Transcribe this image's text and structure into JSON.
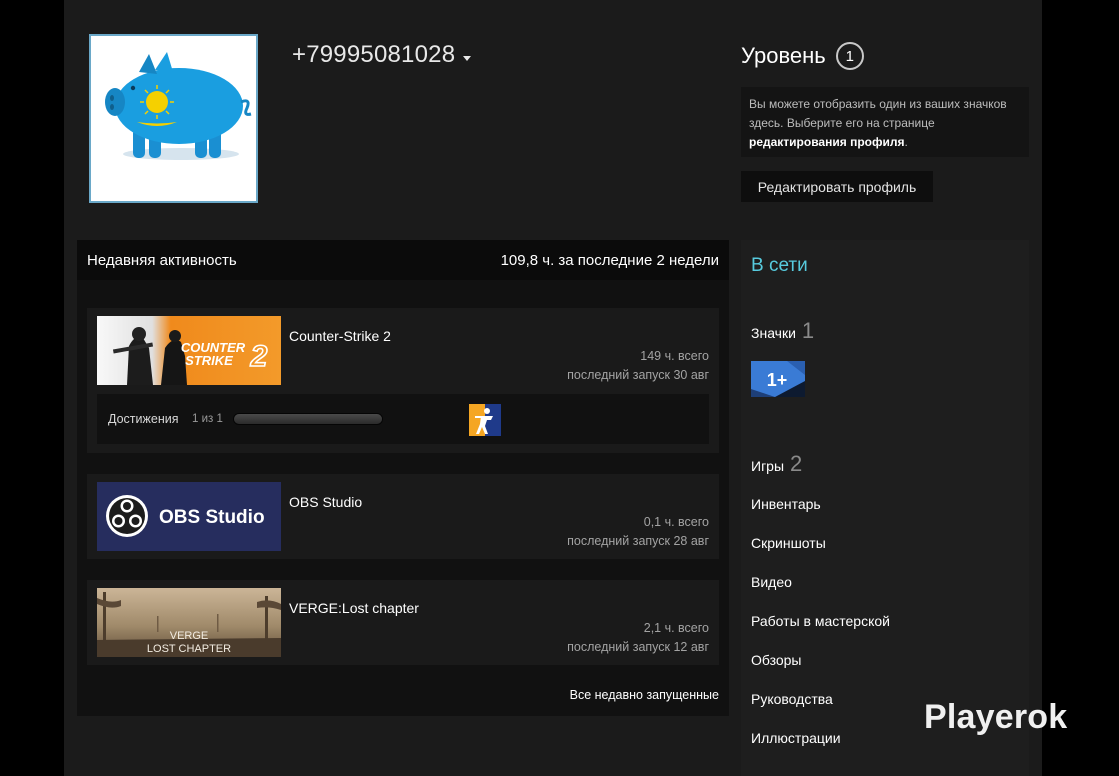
{
  "profile": {
    "persona_name": "+79995081028",
    "level_label": "Уровень",
    "level_value": "1",
    "badge_note_plain": "Вы можете отобразить один из ваших значков здесь. Выберите его на странице ",
    "badge_note_bold": "редактирования профиля",
    "badge_note_end": ".",
    "edit_button": "Редактировать профиль"
  },
  "activity": {
    "title": "Недавняя активность",
    "summary": "109,8 ч. за последние 2 недели",
    "games": [
      {
        "name": "Counter-Strike 2",
        "hours": "149 ч. всего",
        "last_played": "последний запуск 30 авг",
        "capsule_text": [
          "COUNTER",
          "STRIKE",
          "2"
        ],
        "achievements": {
          "label": "Достижения",
          "count": "1 из 1",
          "progress": 1.0
        }
      },
      {
        "name": "OBS Studio",
        "hours": "0,1 ч. всего",
        "last_played": "последний запуск 28 авг",
        "capsule_text": [
          "OBS Studio"
        ]
      },
      {
        "name": "VERGE:Lost chapter",
        "hours": "2,1 ч. всего",
        "last_played": "последний запуск 12 авг",
        "capsule_text": [
          "VERGE",
          "LOST CHAPTER"
        ]
      }
    ],
    "all_recent_link": "Все недавно запущенные"
  },
  "sidebar": {
    "status": "В сети",
    "badges": {
      "label": "Значки",
      "count": "1",
      "thumb_text": "1+"
    },
    "games": {
      "label": "Игры",
      "count": "2"
    },
    "links": [
      "Инвентарь",
      "Скриншоты",
      "Видео",
      "Работы в мастерской",
      "Обзоры",
      "Руководства",
      "Иллюстрации"
    ]
  },
  "watermark": "Playerok",
  "colors": {
    "online": "#57cbde",
    "cs2_orange": "#f08a1c",
    "obs_navy": "#262d5e",
    "flag_blue": "#1a9ee0",
    "flag_gold": "#f5d000",
    "badge_blue": "#3a7bd5"
  }
}
